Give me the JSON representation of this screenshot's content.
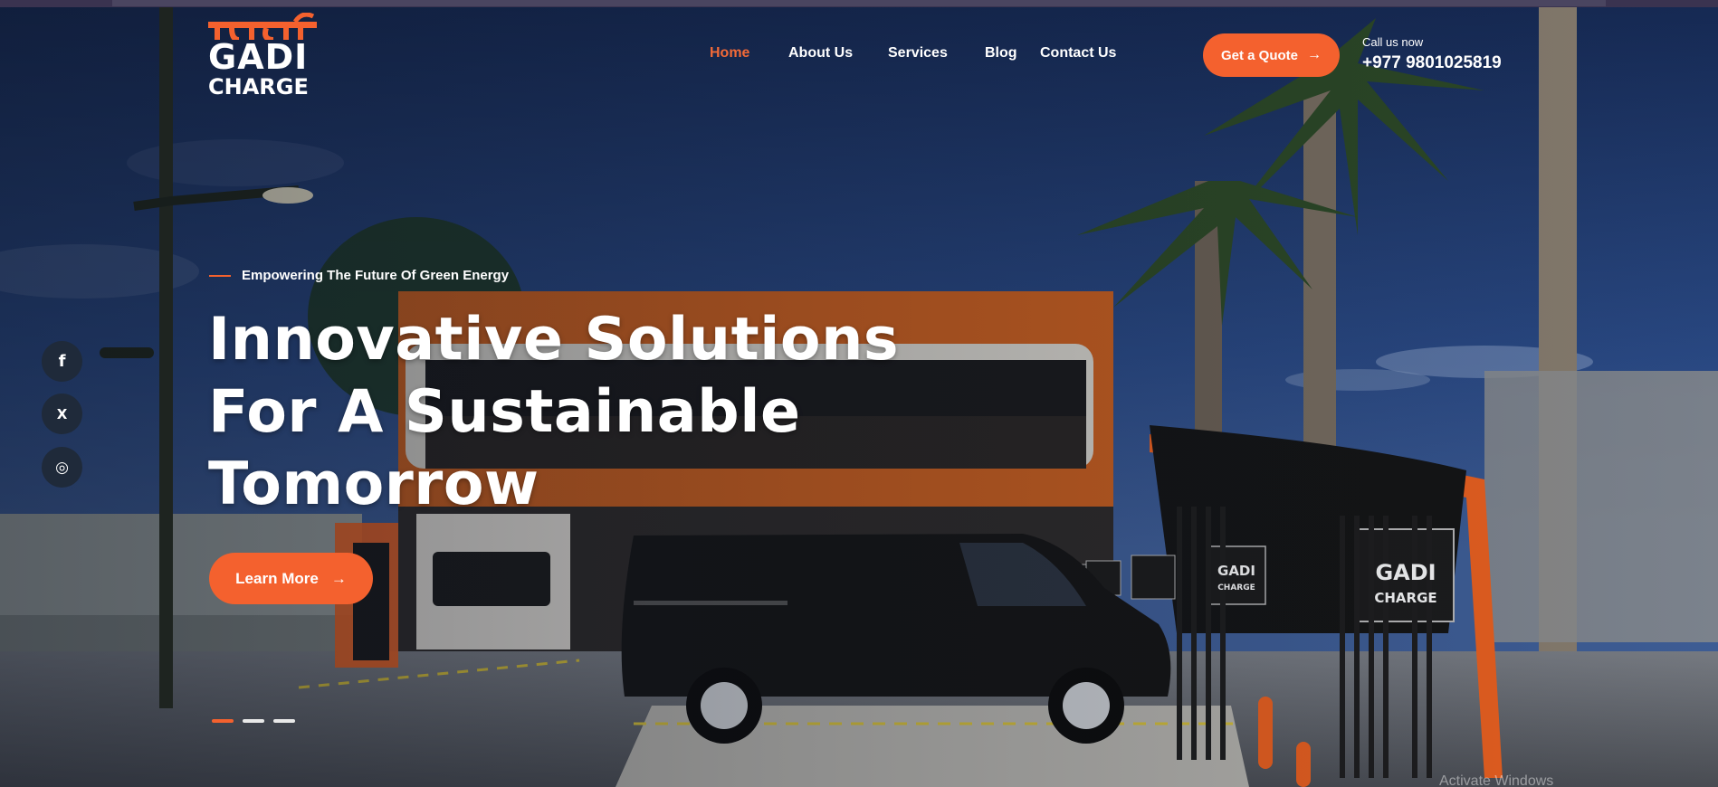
{
  "brand": {
    "logo_line1": "GADI",
    "logo_line2": "CHARGE",
    "accent_color": "#f4612e"
  },
  "nav": {
    "items": [
      {
        "label": "Home",
        "active": true
      },
      {
        "label": "About Us",
        "active": false
      },
      {
        "label": "Services",
        "active": false
      },
      {
        "label": "Blog",
        "active": false
      },
      {
        "label": "Contact Us",
        "active": false
      }
    ]
  },
  "header": {
    "quote_button": "Get a Quote",
    "quote_icon": "arrow-right-icon",
    "call_label": "Call us now",
    "phone": "+977 9801025819"
  },
  "social": [
    {
      "icon": "facebook-icon",
      "glyph": "f"
    },
    {
      "icon": "x-icon",
      "glyph": "X"
    },
    {
      "icon": "instagram-icon",
      "glyph": "◎"
    }
  ],
  "hero": {
    "tagline": "Empowering The Future Of Green Energy",
    "headline_lines": [
      "Innovative Solutions",
      "For A Sustainable",
      "Tomorrow"
    ],
    "cta_label": "Learn More",
    "cta_icon": "arrow-right-icon",
    "slides_total": 3,
    "slide_active": 1
  },
  "station_signs": [
    "GADI",
    "CHARGE"
  ],
  "os_watermark": "Activate Windows"
}
